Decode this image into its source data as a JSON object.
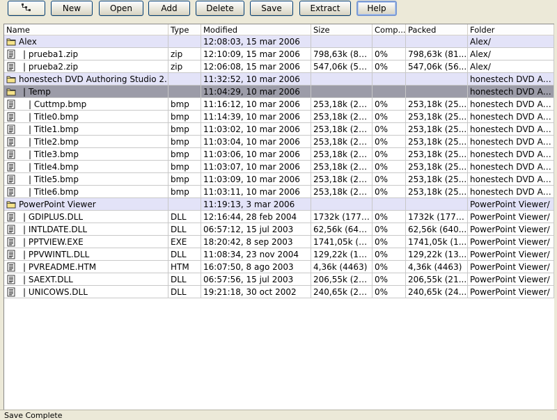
{
  "toolbar": {
    "tree_icon": "tree-view-icon",
    "buttons": [
      {
        "key": "new",
        "label": "New"
      },
      {
        "key": "open",
        "label": "Open"
      },
      {
        "key": "add",
        "label": "Add"
      },
      {
        "key": "delete",
        "label": "Delete"
      },
      {
        "key": "save",
        "label": "Save"
      },
      {
        "key": "extract",
        "label": "Extract"
      },
      {
        "key": "help",
        "label": "Help"
      }
    ]
  },
  "columns": [
    "Name",
    "Type",
    "Modified",
    "Size",
    "Comp...",
    "Packed",
    "Folder"
  ],
  "rows": [
    {
      "kind": "folder",
      "name": "Alex",
      "type": "",
      "modified": "12:08:03, 15 mar 2006",
      "size": "",
      "comp": "",
      "packed": "",
      "folder": "Alex/"
    },
    {
      "kind": "file",
      "name": "| prueba1.zip",
      "type": "zip",
      "modified": "12:10:09, 15 mar 2006",
      "size": "798,63k  (81...",
      "comp": "0%",
      "packed": "798,63k  (81...",
      "folder": "Alex/"
    },
    {
      "kind": "file",
      "name": "| prueba2.zip",
      "type": "zip",
      "modified": "12:06:08, 15 mar 2006",
      "size": "547,06k  (56...",
      "comp": "0%",
      "packed": "547,06k  (56...",
      "folder": "Alex/"
    },
    {
      "kind": "folder",
      "name": "honestech DVD Authoring Studio 2....",
      "type": "",
      "modified": "11:32:52, 10 mar 2006",
      "size": "",
      "comp": "",
      "packed": "",
      "folder": "honestech DVD Au..."
    },
    {
      "kind": "folder",
      "selected": true,
      "name": "| Temp",
      "type": "",
      "modified": "11:04:29, 10 mar 2006",
      "size": "",
      "comp": "",
      "packed": "",
      "folder": "honestech DVD Au..."
    },
    {
      "kind": "file",
      "name": "| Cuttmp.bmp",
      "indent": true,
      "type": "bmp",
      "modified": "11:16:12, 10 mar 2006",
      "size": "253,18k  (25...",
      "comp": "0%",
      "packed": "253,18k  (25...",
      "folder": "honestech DVD Au..."
    },
    {
      "kind": "file",
      "name": "| Title0.bmp",
      "indent": true,
      "type": "bmp",
      "modified": "11:14:39, 10 mar 2006",
      "size": "253,18k  (25...",
      "comp": "0%",
      "packed": "253,18k  (25...",
      "folder": "honestech DVD Au..."
    },
    {
      "kind": "file",
      "name": "| Title1.bmp",
      "indent": true,
      "type": "bmp",
      "modified": "11:03:02, 10 mar 2006",
      "size": "253,18k  (25...",
      "comp": "0%",
      "packed": "253,18k  (25...",
      "folder": "honestech DVD Au..."
    },
    {
      "kind": "file",
      "name": "| Title2.bmp",
      "indent": true,
      "type": "bmp",
      "modified": "11:03:04, 10 mar 2006",
      "size": "253,18k  (25...",
      "comp": "0%",
      "packed": "253,18k  (25...",
      "folder": "honestech DVD Au..."
    },
    {
      "kind": "file",
      "name": "| Title3.bmp",
      "indent": true,
      "type": "bmp",
      "modified": "11:03:06, 10 mar 2006",
      "size": "253,18k  (25...",
      "comp": "0%",
      "packed": "253,18k  (25...",
      "folder": "honestech DVD Au..."
    },
    {
      "kind": "file",
      "name": "| Title4.bmp",
      "indent": true,
      "type": "bmp",
      "modified": "11:03:07, 10 mar 2006",
      "size": "253,18k  (25...",
      "comp": "0%",
      "packed": "253,18k  (25...",
      "folder": "honestech DVD Au..."
    },
    {
      "kind": "file",
      "name": "| Title5.bmp",
      "indent": true,
      "type": "bmp",
      "modified": "11:03:09, 10 mar 2006",
      "size": "253,18k  (25...",
      "comp": "0%",
      "packed": "253,18k  (25...",
      "folder": "honestech DVD Au..."
    },
    {
      "kind": "file",
      "name": "| Title6.bmp",
      "indent": true,
      "type": "bmp",
      "modified": "11:03:11, 10 mar 2006",
      "size": "253,18k  (25...",
      "comp": "0%",
      "packed": "253,18k  (25...",
      "folder": "honestech DVD Au..."
    },
    {
      "kind": "folder",
      "name": "PowerPoint Viewer",
      "type": "",
      "modified": "11:19:13, 3 mar 2006",
      "size": "",
      "comp": "",
      "packed": "",
      "folder": "PowerPoint Viewer/"
    },
    {
      "kind": "file",
      "name": "| GDIPLUS.DLL",
      "type": "DLL",
      "modified": "12:16:44, 28 feb 2004",
      "size": "1732k  (1773...",
      "comp": "0%",
      "packed": "1732k  (1773...",
      "folder": "PowerPoint Viewer/"
    },
    {
      "kind": "file",
      "name": "| INTLDATE.DLL",
      "type": "DLL",
      "modified": "06:57:12, 15 jul 2003",
      "size": "62,56k  (640...",
      "comp": "0%",
      "packed": "62,56k  (640...",
      "folder": "PowerPoint Viewer/"
    },
    {
      "kind": "file",
      "name": "| PPTVIEW.EXE",
      "type": "EXE",
      "modified": "18:20:42, 8 sep 2003",
      "size": "1741,05k  (1...",
      "comp": "0%",
      "packed": "1741,05k  (1...",
      "folder": "PowerPoint Viewer/"
    },
    {
      "kind": "file",
      "name": "| PPVWINTL.DLL",
      "type": "DLL",
      "modified": "11:08:34, 23 nov 2004",
      "size": "129,22k  (13...",
      "comp": "0%",
      "packed": "129,22k  (13...",
      "folder": "PowerPoint Viewer/"
    },
    {
      "kind": "file",
      "name": "| PVREADME.HTM",
      "type": "HTM",
      "modified": "16:07:50, 8 ago 2003",
      "size": "4,36k  (4463)",
      "comp": "0%",
      "packed": "4,36k  (4463)",
      "folder": "PowerPoint Viewer/"
    },
    {
      "kind": "file",
      "name": "| SAEXT.DLL",
      "type": "DLL",
      "modified": "06:57:56, 15 jul 2003",
      "size": "206,55k  (21...",
      "comp": "0%",
      "packed": "206,55k  (21...",
      "folder": "PowerPoint Viewer/"
    },
    {
      "kind": "file",
      "name": "| UNICOWS.DLL",
      "type": "DLL",
      "modified": "19:21:18, 30 oct 2002",
      "size": "240,65k  (24...",
      "comp": "0%",
      "packed": "240,65k  (24...",
      "folder": "PowerPoint Viewer/"
    }
  ],
  "status": {
    "text": "Save Complete"
  },
  "icons": {
    "folder": "folder-icon",
    "file": "file-icon"
  }
}
